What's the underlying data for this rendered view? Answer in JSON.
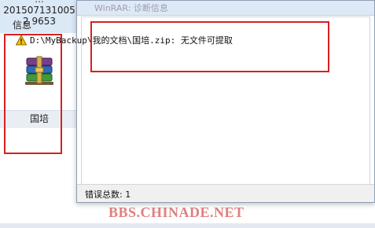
{
  "desktop": {
    "top_file": {
      "label_line_cut": "...",
      "label": "2015071310052 9653"
    },
    "rar_file": {
      "label": "国培",
      "icon": "winrar-archive-icon"
    }
  },
  "dialog": {
    "title": "WinRAR: 诊断信息",
    "info_header": "信息",
    "message": "D:\\MyBackup\\我的文档\\国培.zip: 无文件可提取",
    "warning_icon": "warning-triangle-icon",
    "status": "错误总数: 1"
  },
  "watermark": "BBS.CHINADE.NET",
  "colors": {
    "highlight_red": "#d62020",
    "watermark": "#e07f80"
  }
}
